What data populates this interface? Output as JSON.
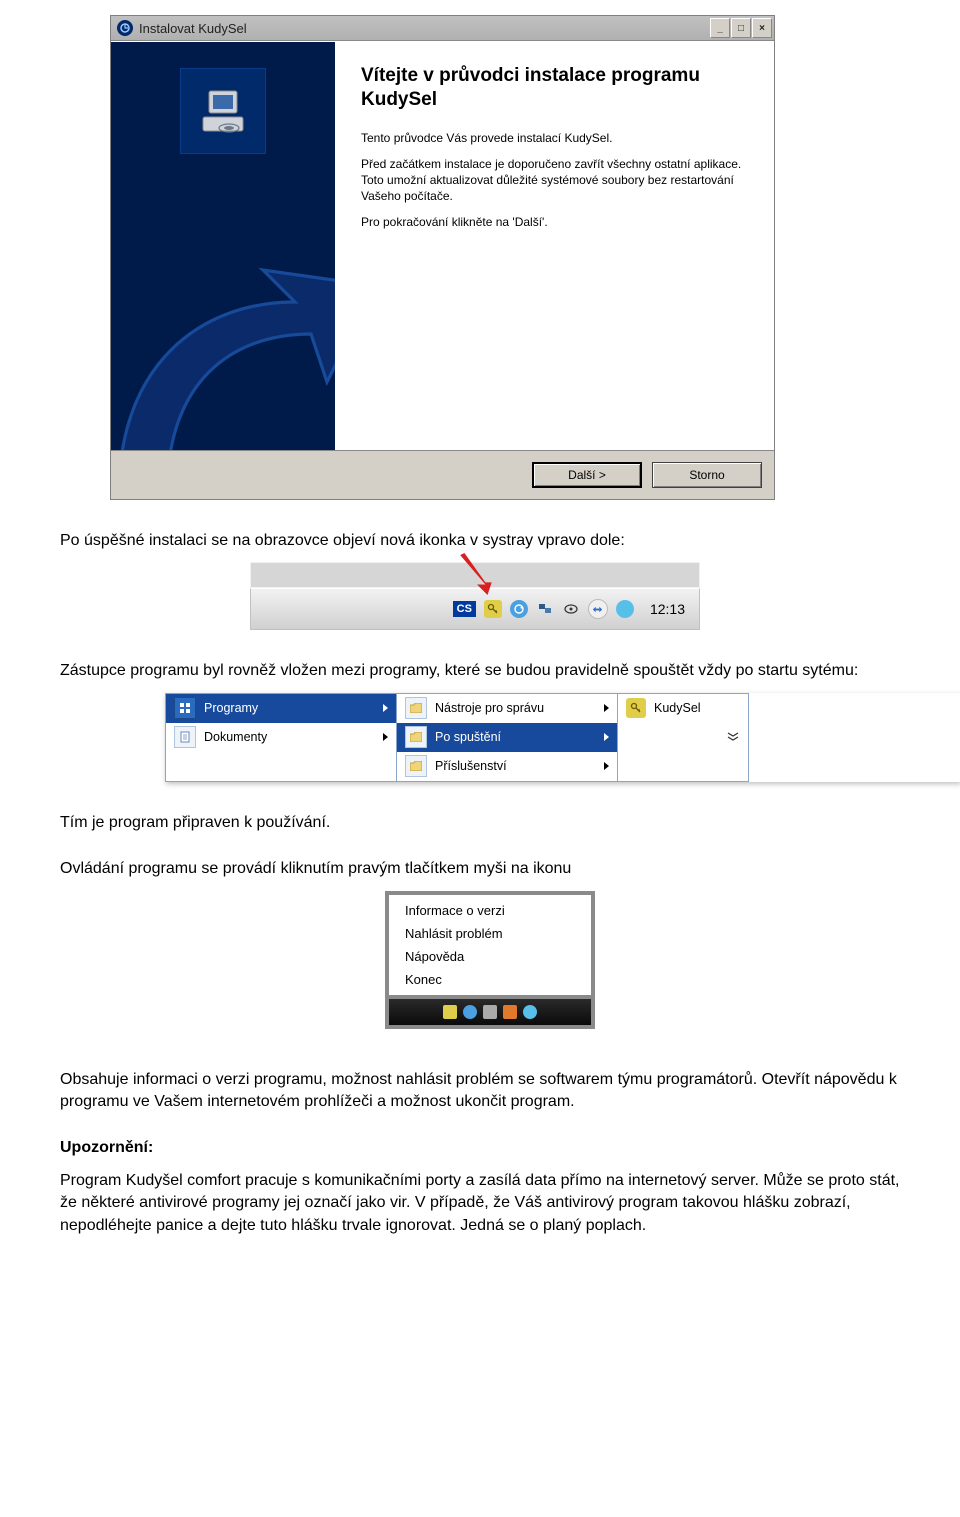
{
  "installer": {
    "title": "Instalovat KudySel",
    "heading": "Vítejte v průvodci instalace programu KudySel",
    "p1": "Tento průvodce Vás provede instalací KudySel.",
    "p2": "Před začátkem instalace je doporučeno zavřít všechny ostatní aplikace. Toto umožní aktualizovat důležité systémové soubory bez restartování Vašeho počítače.",
    "p3": "Pro pokračování klikněte na 'Další'.",
    "btn_next": "Další >",
    "btn_cancel": "Storno"
  },
  "doc": {
    "p1": "Po úspěšné instalaci se na obrazovce objeví nová ikonka v systray vpravo dole:",
    "p2": "Zástupce programu byl rovněž vložen mezi programy, které se budou pravidelně spouštět vždy po startu sytému:",
    "p3": "Tím je program připraven k používání.",
    "p4": "Ovládání programu se provádí kliknutím pravým tlačítkem myši na ikonu",
    "p5": "Obsahuje informaci o verzi programu, možnost nahlásit problém se softwarem týmu programátorů. Otevřít nápovědu k programu ve Vašem internetovém prohlížeči a možnost ukončit program.",
    "warn_label": "Upozornění:",
    "p6": "Program Kudyšel comfort pracuje s komunikačními porty a zasílá data přímo na internetový server. Může se proto stát, že některé antivirové programy jej označí jako vir. V případě, že Váš antivirový program takovou hlášku zobrazí, nepodléhejte panice a dejte tuto hlášku trvale ignorovat. Jedná se o planý poplach."
  },
  "systray": {
    "lang": "CS",
    "clock": "12:13"
  },
  "startmenu": {
    "col1": {
      "item1": "Programy",
      "item2": "Dokumenty"
    },
    "col2": {
      "item1": "Nástroje pro správu",
      "item2": "Po spuštění",
      "item3": "Příslušenství"
    },
    "col3": {
      "item1": "KudySel"
    }
  },
  "contextmenu": {
    "i1": "Informace o verzi",
    "i2": "Nahlásit problém",
    "i3": "Nápověda",
    "i4": "Konec"
  }
}
